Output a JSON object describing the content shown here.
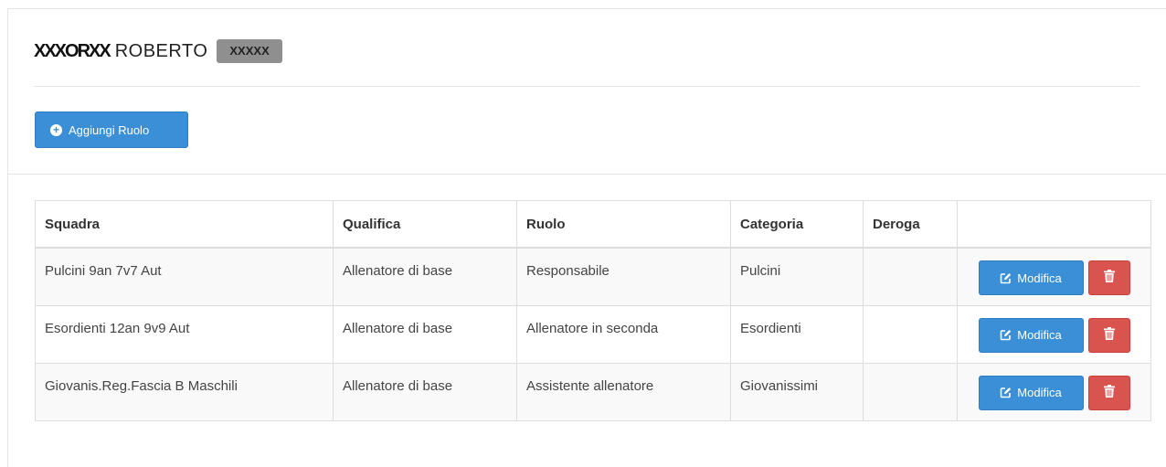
{
  "person": {
    "surname_mark": "XXXORXX",
    "first_name": "ROBERTO",
    "id_badge": "XXXXX"
  },
  "toolbar": {
    "add_role_label": "Aggiungi Ruolo"
  },
  "table": {
    "headers": [
      "Squadra",
      "Qualifica",
      "Ruolo",
      "Categoria",
      "Deroga",
      ""
    ],
    "rows": [
      {
        "squadra": "Pulcini 9an 7v7 Aut",
        "qualifica": "Allenatore di base",
        "ruolo": "Responsabile",
        "categoria": "Pulcini",
        "deroga": "",
        "edit_label": "Modifica"
      },
      {
        "squadra": "Esordienti 12an 9v9 Aut",
        "qualifica": "Allenatore di base",
        "ruolo": "Allenatore in seconda",
        "categoria": "Esordienti",
        "deroga": "",
        "edit_label": "Modifica"
      },
      {
        "squadra": "Giovanis.Reg.Fascia B Maschili",
        "qualifica": "Allenatore di base",
        "ruolo": "Assistente allenatore",
        "categoria": "Giovanissimi",
        "deroga": "",
        "edit_label": "Modifica"
      }
    ]
  },
  "icons": {
    "add": "plus-circle-icon",
    "edit": "edit-icon",
    "delete": "trash-icon"
  },
  "colors": {
    "primary": "#3a8fd6",
    "danger": "#d9534f",
    "badge": "#8f8f8f"
  }
}
